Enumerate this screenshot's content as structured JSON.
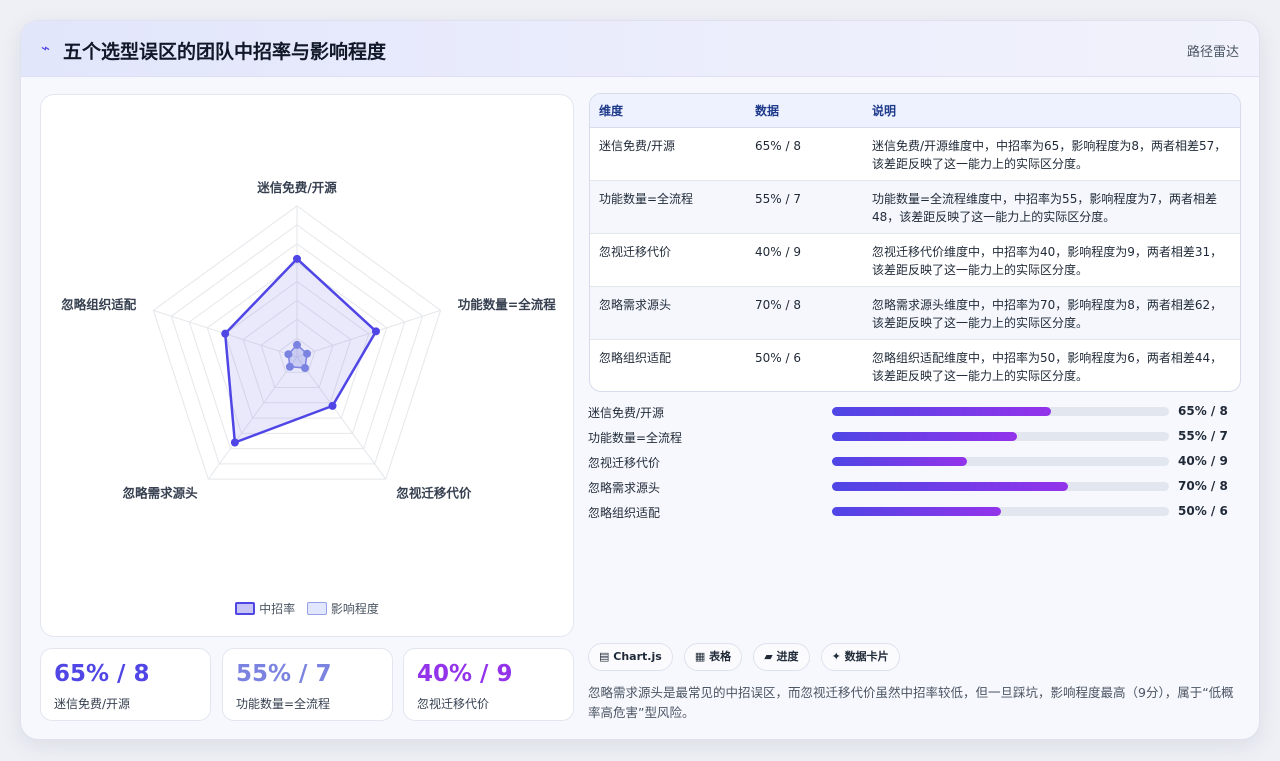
{
  "header": {
    "icon": "zigzag-chart-icon",
    "title": "五个选型误区的团队中招率与影响程度",
    "tag": "路径雷达"
  },
  "colors": {
    "accent": "#4f46e5",
    "accent2": "#9333ea",
    "rate_line": "#4f46e5",
    "impact_line": "#7b83e0"
  },
  "chart_data": {
    "type": "radar",
    "axes": [
      "迷信免费/开源",
      "功能数量=全流程",
      "忽视迁移代价",
      "忽略需求源头",
      "忽略组织适配"
    ],
    "series": [
      {
        "name": "中招率",
        "values": [
          65,
          55,
          40,
          70,
          50
        ]
      },
      {
        "name": "影响程度",
        "values": [
          8,
          7,
          9,
          8,
          6
        ]
      }
    ],
    "range": [
      0,
      100
    ],
    "grid_levels": 8,
    "legend": [
      "中招率",
      "影响程度"
    ],
    "legend_position": "bottom"
  },
  "stats": [
    {
      "value": "65% / 8",
      "label": "迷信免费/开源",
      "color": "#4f46e5"
    },
    {
      "value": "55% / 7",
      "label": "功能数量=全流程",
      "color": "#7b83e0"
    },
    {
      "value": "40% / 9",
      "label": "忽视迁移代价",
      "color": "#9333ea"
    }
  ],
  "table": {
    "headers": [
      "维度",
      "数据",
      "说明"
    ],
    "rows": [
      {
        "dim": "迷信免费/开源",
        "data": "65% / 8",
        "desc": "迷信免费/开源维度中，中招率为65，影响程度为8，两者相差57，该差距反映了这一能力上的实际区分度。"
      },
      {
        "dim": "功能数量=全流程",
        "data": "55% / 7",
        "desc": "功能数量=全流程维度中，中招率为55，影响程度为7，两者相差48，该差距反映了这一能力上的实际区分度。"
      },
      {
        "dim": "忽视迁移代价",
        "data": "40% / 9",
        "desc": "忽视迁移代价维度中，中招率为40，影响程度为9，两者相差31，该差距反映了这一能力上的实际区分度。"
      },
      {
        "dim": "忽略需求源头",
        "data": "70% / 8",
        "desc": "忽略需求源头维度中，中招率为70，影响程度为8，两者相差62，该差距反映了这一能力上的实际区分度。"
      },
      {
        "dim": "忽略组织适配",
        "data": "50% / 6",
        "desc": "忽略组织适配维度中，中招率为50，影响程度为6，两者相差44，该差距反映了这一能力上的实际区分度。"
      }
    ]
  },
  "progress": [
    {
      "label": "迷信免费/开源",
      "value": "65% / 8",
      "percent": 65
    },
    {
      "label": "功能数量=全流程",
      "value": "55% / 7",
      "percent": 55
    },
    {
      "label": "忽视迁移代价",
      "value": "40% / 9",
      "percent": 40
    },
    {
      "label": "忽略需求源头",
      "value": "70% / 8",
      "percent": 70
    },
    {
      "label": "忽略组织适配",
      "value": "50% / 6",
      "percent": 50
    }
  ],
  "chips": [
    {
      "icon": "chart-icon",
      "glyph": "▤",
      "label": "Chart.js"
    },
    {
      "icon": "table-icon",
      "glyph": "▦",
      "label": "表格"
    },
    {
      "icon": "progress-icon",
      "glyph": "▰",
      "label": "进度"
    },
    {
      "icon": "sparkle-icon",
      "glyph": "✦",
      "label": "数据卡片"
    }
  ],
  "note": "忽略需求源头是最常见的中招误区，而忽视迁移代价虽然中招率较低，但一旦踩坑，影响程度最高（9分），属于“低概率高危害”型风险。"
}
